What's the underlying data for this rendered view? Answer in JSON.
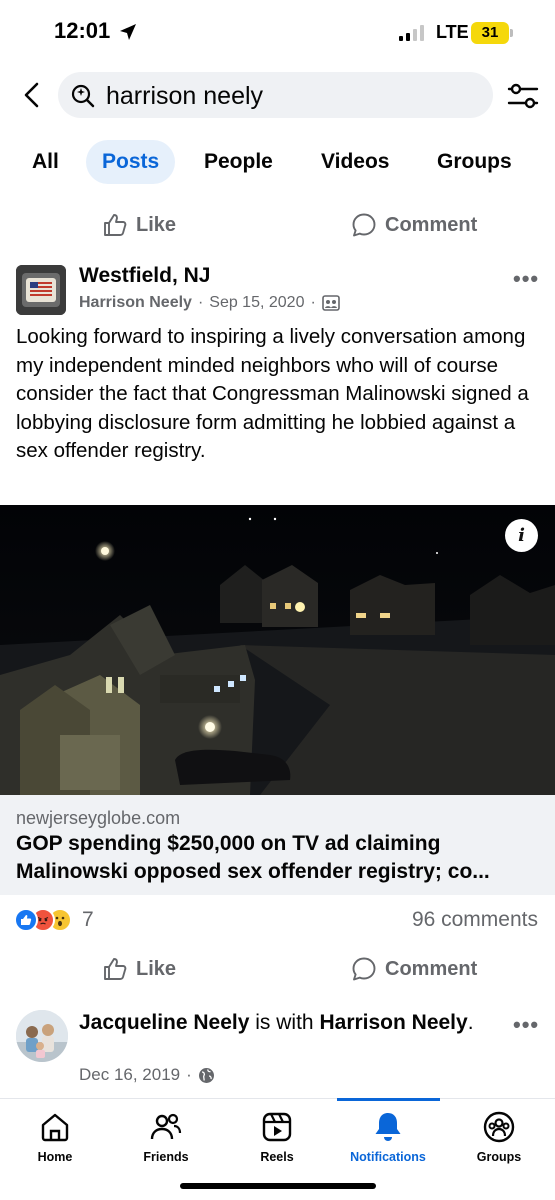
{
  "status_bar": {
    "time": "12:01",
    "network": "LTE",
    "battery": "31",
    "battery_color": "#f5d80b"
  },
  "search": {
    "query": "harrison neely",
    "icon": "search-icon"
  },
  "tabs": [
    {
      "label": "All",
      "active": false
    },
    {
      "label": "Posts",
      "active": true
    },
    {
      "label": "People",
      "active": false
    },
    {
      "label": "Videos",
      "active": false
    },
    {
      "label": "Groups",
      "active": false
    }
  ],
  "actions": {
    "like": "Like",
    "comment": "Comment"
  },
  "post": {
    "page_name": "Westfield, NJ",
    "author": "Harrison Neely",
    "date": "Sep 15, 2020",
    "separator": "·",
    "audience_icon": "group-audience-icon",
    "text": "Looking forward to inspiring a lively conversation among my independent minded neighbors who will of course consider the fact that Congressman Malinowski signed a lobbying disclosure form admitting he lobbied against a sex offender registry.",
    "link": {
      "domain": "newjerseyglobe.com",
      "title": "GOP spending $250,000 on TV ad claiming Malinowski opposed sex offender registry; co..."
    },
    "reactions": {
      "icons": [
        "like-reaction-icon",
        "angry-reaction-icon",
        "wow-reaction-icon"
      ],
      "count": "7"
    },
    "comments": "96 comments"
  },
  "post2": {
    "author": "Jacqueline Neely",
    "connector": "is with",
    "tagged": "Harrison Neely",
    "period": ".",
    "date": "Dec 16, 2019",
    "separator": "·",
    "audience_icon": "globe-icon"
  },
  "bottom_nav": [
    {
      "label": "Home",
      "icon": "home-icon",
      "active": false
    },
    {
      "label": "Friends",
      "icon": "friends-icon",
      "active": false
    },
    {
      "label": "Reels",
      "icon": "reels-icon",
      "active": false
    },
    {
      "label": "Notifications",
      "icon": "bell-icon",
      "active": true
    },
    {
      "label": "Groups",
      "icon": "groups-icon",
      "active": false
    }
  ],
  "colors": {
    "accent": "#0a66d8",
    "secondary_text": "#65676b",
    "tab_active_bg": "#e6f0fb"
  }
}
